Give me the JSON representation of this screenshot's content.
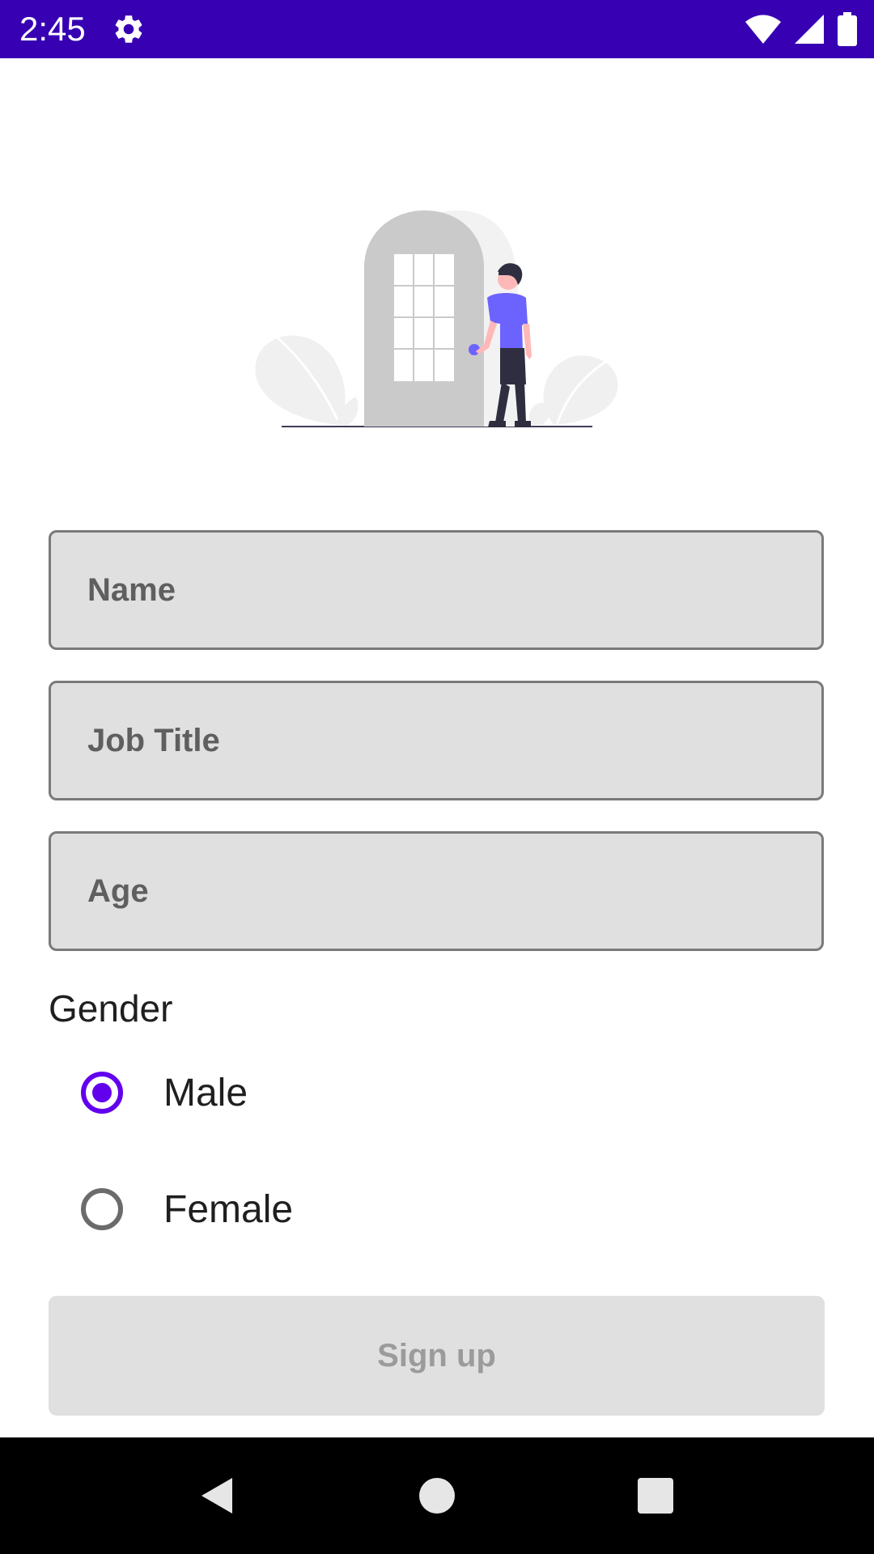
{
  "status_bar": {
    "time": "2:45",
    "background_color": "#3700b3",
    "icons": [
      "gear-icon",
      "wifi-icon",
      "cell-signal-icon",
      "battery-icon"
    ]
  },
  "illustration": {
    "description_icon": "person-at-door-illustration",
    "accent_color": "#6c63ff"
  },
  "form": {
    "name_placeholder": "Name",
    "name_value": "",
    "job_title_placeholder": "Job Title",
    "job_title_value": "",
    "age_placeholder": "Age",
    "age_value": "",
    "gender_label": "Gender",
    "gender_options": [
      {
        "label": "Male",
        "selected": true
      },
      {
        "label": "Female",
        "selected": false
      }
    ],
    "signup_label": "Sign up",
    "signup_enabled": false,
    "accent_color": "#6200ee"
  },
  "nav_bar": {
    "buttons": [
      "back-icon",
      "home-icon",
      "recents-icon"
    ]
  }
}
